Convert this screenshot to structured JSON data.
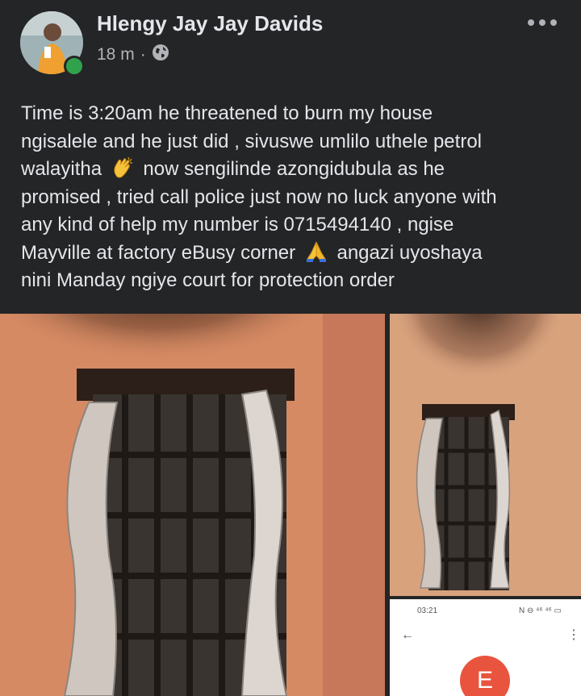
{
  "post": {
    "author": "Hlengy Jay Jay Davids",
    "time": "18 m",
    "separator": "·",
    "privacy_icon": "globe-icon",
    "more_icon": "more-horizontal-icon",
    "text_lines": [
      "Time is 3:20am he threatened to burn my house",
      "ngisalele and he just did , sivuswe umlilo uthele petrol",
      "walayitha",
      "now sengilinde azongidubula as he",
      "promised , tried call police just now no luck anyone with",
      "any kind of help my number is 0715494140 , ngise",
      "Mayville at factory eBusy corner",
      "angazi uyoshaya",
      "nini Manday ngiye court for protection order"
    ],
    "emojis": [
      "clapping-hands-emoji",
      "folded-hands-emoji"
    ]
  },
  "phone_screenshot": {
    "time": "03:21",
    "status_icons": "N ⊖ ⁴⁶ ⁴⁶ ▭",
    "contact_initial": "E"
  },
  "colors": {
    "background": "#242526",
    "text_primary": "#e4e6eb",
    "text_secondary": "#b0b3b8",
    "online": "#31a24c",
    "contact_badge": "#e8543e"
  }
}
